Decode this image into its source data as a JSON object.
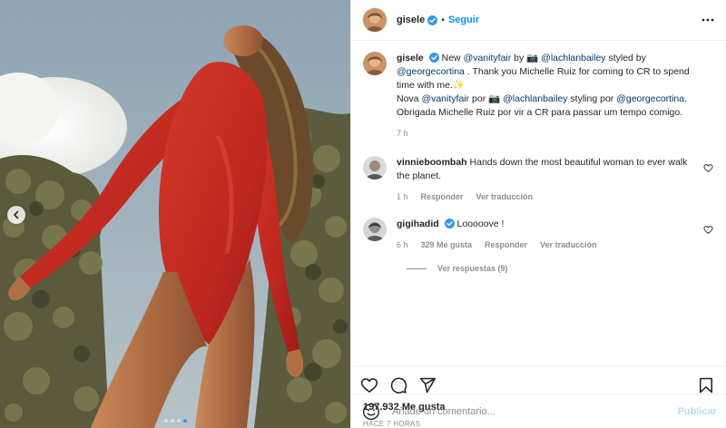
{
  "post": {
    "author": {
      "username": "gisele",
      "verified": true,
      "follow_label": "Seguir",
      "separator": "•"
    },
    "media": {
      "carousel_dots": 4,
      "active_dot": 4,
      "prev_icon": "chevron-left-icon"
    },
    "caption": {
      "username": "gisele",
      "segments": [
        {
          "text": "New ",
          "type": "text"
        },
        {
          "text": "@vanityfair",
          "type": "mention"
        },
        {
          "text": " by 📷 ",
          "type": "text"
        },
        {
          "text": "@lachlanbailey",
          "type": "mention"
        },
        {
          "text": " styled by ",
          "type": "text"
        },
        {
          "text": "@georgecortina",
          "type": "mention"
        },
        {
          "text": " . Thank you Michelle Ruiz for coming to CR to spend time with me.✨",
          "type": "text"
        },
        {
          "text": "Nova ",
          "type": "text",
          "newline": true
        },
        {
          "text": "@vanityfair",
          "type": "mention"
        },
        {
          "text": " por 📷 ",
          "type": "text"
        },
        {
          "text": "@lachlanbailey",
          "type": "mention"
        },
        {
          "text": " styling por ",
          "type": "text"
        },
        {
          "text": "@georgecortina",
          "type": "mention"
        },
        {
          "text": ". Obrigada Michelle Ruiz por vir a CR para passar um tempo comigo.",
          "type": "text"
        }
      ],
      "time": "7 h"
    },
    "comments": [
      {
        "username": "vinnieboombah",
        "text": "Hands down the most beautiful woman to ever walk the planet.",
        "time": "1 h",
        "reply_label": "Responder",
        "translate_label": "Ver traducción",
        "likes": ""
      },
      {
        "username": "gigihadid",
        "text": "Looooove !",
        "time": "6 h",
        "likes": "329 Me gusta",
        "reply_label": "Responder",
        "translate_label": "Ver traducción",
        "view_replies_label": "Ver respuestas (9)"
      }
    ],
    "likes_label": "197.932 Me gusta",
    "posted_ago": "HACE 7 HORAS",
    "add_comment": {
      "placeholder": "Añade un comentario...",
      "publish_label": "Publicar",
      "emoji_icon": "smile-icon"
    },
    "icons": {
      "like": "heart-icon",
      "comment": "comment-icon",
      "share": "send-icon",
      "save": "bookmark-icon",
      "more": "more-horizontal-icon",
      "verified": "verified-badge-icon"
    },
    "colors": {
      "accent": "#0095f6",
      "verified": "#3897f0",
      "secondary_text": "#8e8e8e",
      "mention": "#00376b",
      "publish_disabled": "#b2dffc"
    }
  }
}
